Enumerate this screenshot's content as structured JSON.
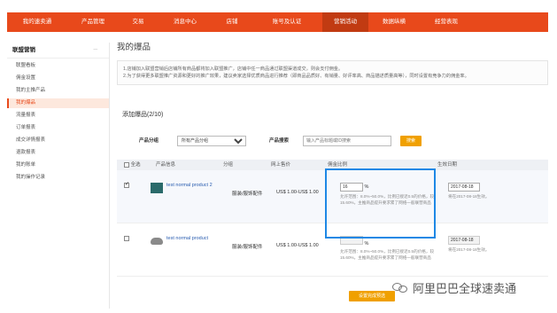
{
  "topnav": {
    "tabs": [
      "我的速卖通",
      "产品管理",
      "交易",
      "消息中心",
      "店铺",
      "账号及认证",
      "营销活动",
      "数据纵横",
      "经营表现"
    ],
    "active_index": 6
  },
  "sidebar": {
    "header": "联盟营销",
    "collapse_icon": "－",
    "items": [
      "联盟看板",
      "佣金设置",
      "我的主推产品",
      "我的爆品",
      "流量报表",
      "订单报表",
      "成交详情报表",
      "退款报表",
      "我的账单",
      "我的操作记录"
    ],
    "active_index": 3
  },
  "main": {
    "title": "我的爆品",
    "notes": [
      "1.店铺加入联盟营销后店铺所有商品都将加入联盟推广，店铺中任一商品通过联盟渠道成交，则会支付佣金。",
      "2.为了获得更多联盟推广资源和更好的推广效果，建议卖家选择优质商品进行推荐（即商品品质好、有销量、好评率高、商品描述质量高等），同时设置有竞争力的佣金率。"
    ],
    "section_title": "添加爆品(2/10)",
    "filter": {
      "category_label": "产品分组",
      "category_value": "所有产品分组",
      "search_label": "产品搜索",
      "search_placeholder": "输入产品标题或ID搜索",
      "search_button": "搜索"
    },
    "table": {
      "headers": {
        "select_all": "全选",
        "product_info": "产品信息",
        "group": "分组",
        "price": "网上售价",
        "commission": "佣金比例",
        "effective_date": "生效日期"
      },
      "rows": [
        {
          "selected": true,
          "title": "test normal product 2",
          "group": "服装/服饰配件",
          "price": "US$ 1.00-US$ 1.00",
          "ratio": "16",
          "ratio_unit": "%",
          "ratio_hint": "允许范围：8.0%~50.0%，比例已接近0.5的价格，较15.60%，主推商品提升要求累了网络一般联营商品",
          "date": "2017-08-18",
          "date_note": "将在2017-08-18生效。"
        },
        {
          "selected": false,
          "title": "test normal product",
          "group": "服装/服饰配件",
          "price": "US$ 1.00-US$ 1.00",
          "ratio": "",
          "ratio_unit": "%",
          "ratio_hint": "允许范围：8.0%~50.0%，比例已接近0.5的价格，较15.60%，主推商品提升要求累了网络一般联营商品",
          "date": "2017-08-18",
          "date_note": "将在2017-08-18生效。"
        }
      ]
    },
    "bottom_button": "设置完成预选",
    "watermark": "阿里巴巴全球速卖通"
  }
}
